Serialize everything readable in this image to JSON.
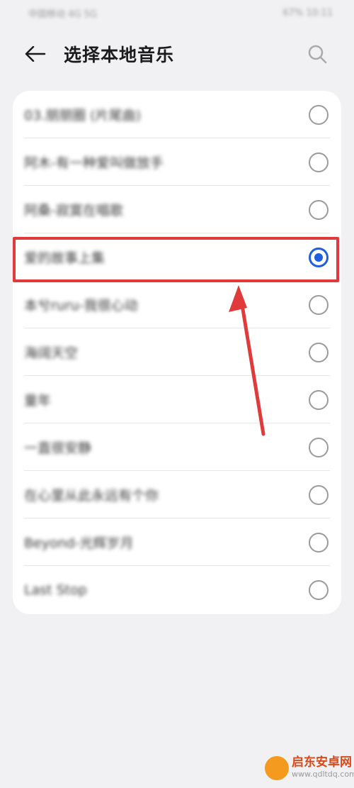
{
  "status_bar": {
    "left_text": "中国移动 4G 5G",
    "right_text": "67% 10:11"
  },
  "header": {
    "title": "选择本地音乐"
  },
  "songs": [
    {
      "label": "03.朋朋圈 (片尾曲)",
      "selected": false
    },
    {
      "label": "阿木-有一种爱叫做放手",
      "selected": false
    },
    {
      "label": "阿桑-寂寞在唱歌",
      "selected": false
    },
    {
      "label": "爱的故事上集",
      "selected": true
    },
    {
      "label": "本兮ruru-我很心动",
      "selected": false
    },
    {
      "label": "海阔天空",
      "selected": false
    },
    {
      "label": "童年",
      "selected": false
    },
    {
      "label": "一直很安静",
      "selected": false
    },
    {
      "label": "在心里从此永远有个你",
      "selected": false
    },
    {
      "label": "Beyond-光辉岁月",
      "selected": false
    },
    {
      "label": "Last Stop",
      "selected": false
    }
  ],
  "colors": {
    "accent": "#1f5ee0",
    "annotation": "#e03a3a",
    "background": "#f1f1f3"
  },
  "watermark": {
    "title": "启东安卓网",
    "url": "www.qdltdq.com"
  }
}
